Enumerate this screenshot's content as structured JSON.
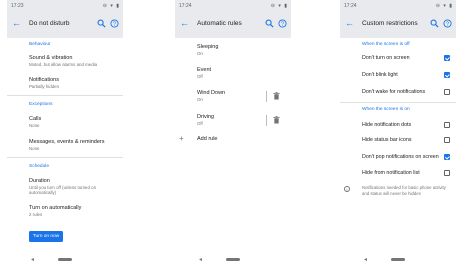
{
  "colors": {
    "accent": "#1a73e8",
    "appbar": "#e8eaed"
  },
  "screen1": {
    "time": "17:23",
    "title": "Do not disturb",
    "sections": {
      "behaviour": "Behaviour",
      "exceptions": "Exceptions",
      "schedule": "Schedule"
    },
    "items": {
      "sound_title": "Sound & vibration",
      "sound_sub": "Muted, but allow alarms and media",
      "notif_title": "Notifications",
      "notif_sub": "Partially hidden",
      "calls_title": "Calls",
      "calls_sub": "None",
      "messages_title": "Messages, events & reminders",
      "messages_sub": "None",
      "duration_title": "Duration",
      "duration_sub": "Until you turn off (unless turned on automatically)",
      "auto_title": "Turn on automatically",
      "auto_sub": "2 rules"
    },
    "button": "Turn on now"
  },
  "screen2": {
    "time": "17:24",
    "title": "Automatic rules",
    "rules": [
      {
        "title": "Sleeping",
        "status": "On"
      },
      {
        "title": "Event",
        "status": "Off"
      },
      {
        "title": "Wind Down",
        "status": "On"
      },
      {
        "title": "Driving",
        "status": "Off"
      }
    ],
    "add_label": "Add rule"
  },
  "screen3": {
    "time": "17:24",
    "title": "Custom restrictions",
    "section_off": "When the screen is off",
    "section_on": "When the screen is on",
    "off_items": [
      {
        "label": "Don't turn on screen",
        "checked": true
      },
      {
        "label": "Don't blink light",
        "checked": true
      },
      {
        "label": "Don't wake for notifications",
        "checked": false
      }
    ],
    "on_items": [
      {
        "label": "Hide notification dots",
        "checked": false
      },
      {
        "label": "Hide status bar icons",
        "checked": false
      },
      {
        "label": "Don't pop notifications on screen",
        "checked": true
      },
      {
        "label": "Hide from notification list",
        "checked": false
      }
    ],
    "info": "Notifications needed for basic phone activity and status will never be hidden"
  }
}
